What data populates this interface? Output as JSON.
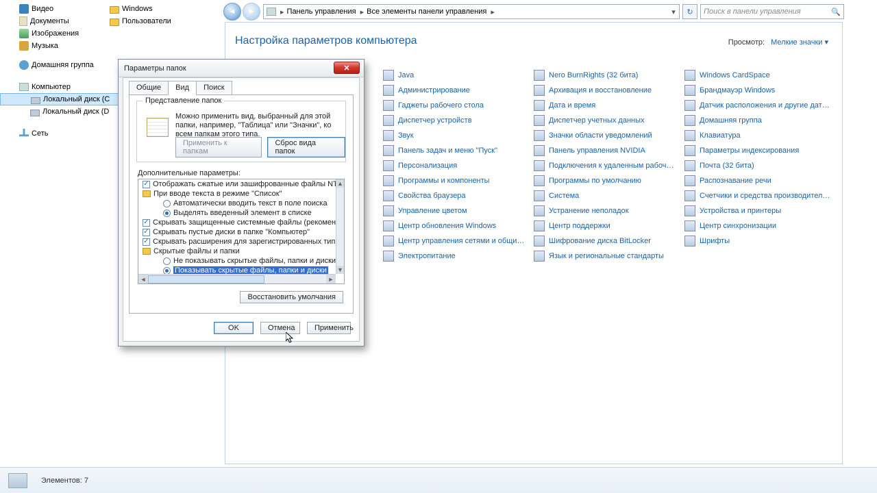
{
  "tree": {
    "video": "Видео",
    "documents": "Документы",
    "images": "Изображения",
    "music": "Музыка",
    "windows": "Windows",
    "users": "Пользователи",
    "homegroup": "Домашняя группа",
    "computer": "Компьютер",
    "localC": "Локальный диск (C",
    "localD": "Локальный диск (D",
    "network": "Сеть"
  },
  "address": {
    "seg1": "Панель управления",
    "seg2": "Все элементы панели управления",
    "search_placeholder": "Поиск в панели управления"
  },
  "heading": "Настройка параметров компьютера",
  "view": {
    "label": "Просмотр:",
    "value": "Мелкие значки"
  },
  "cp": {
    "col1": [
      "Java",
      "Администрирование",
      "Гаджеты рабочего стола",
      "Диспетчер устройств",
      "Звук",
      "Панель задач и меню \"Пуск\"",
      "Персонализация",
      "Программы и компоненты",
      "Свойства браузера",
      "Управление цветом",
      "Центр обновления Windows",
      "Центр управления сетями и общи…",
      "Электропитание"
    ],
    "col2": [
      "Nero BurnRights (32 бита)",
      "Архивация и восстановление",
      "Дата и время",
      "Диспетчер учетных данных",
      "Значки области уведомлений",
      "Панель управления NVIDIA",
      "Подключения к удаленным рабоч…",
      "Программы по умолчанию",
      "Система",
      "Устранение неполадок",
      "Центр поддержки",
      "Шифрование диска BitLocker",
      "Язык и региональные стандарты"
    ],
    "col3": [
      "Windows CardSpace",
      "Брандмауэр Windows",
      "Датчик расположения и другие дат…",
      "Домашняя группа",
      "Клавиатура",
      "Параметры индексирования",
      "Почта (32 бита)",
      "Распознавание речи",
      "Счетчики и средства производител…",
      "Устройства и принтеры",
      "Центр синхронизации",
      "Шрифты"
    ]
  },
  "status": {
    "text": "Элементов: 7"
  },
  "dialog": {
    "title": "Параметры папок",
    "tabs": {
      "general": "Общие",
      "view": "Вид",
      "search": "Поиск"
    },
    "group_title": "Представление папок",
    "group_text": "Можно применить вид, выбранный для этой папки, например, \"Таблица\" или \"Значки\", ко всем папкам этого типа.",
    "apply_folders": "Применить к папкам",
    "reset_folders": "Сброс вида папок",
    "advanced_label": "Дополнительные параметры:",
    "rows": {
      "r1": "Отображать сжатые или зашифрованные файлы NTI",
      "r2": "При вводе текста в режиме \"Список\"",
      "r3": "Автоматически вводить текст в поле поиска",
      "r4": "Выделять введенный элемент в списке",
      "r5": "Скрывать защищенные системные файлы (рекомен.",
      "r6": "Скрывать пустые диски в папке \"Компьютер\"",
      "r7": "Скрывать расширения для зарегистрированных тип",
      "r8": "Скрытые файлы и папки",
      "r9": "Не показывать скрытые файлы, папки и диски",
      "r10": "Показывать скрытые файлы, папки и диски"
    },
    "restore_defaults": "Восстановить умолчания",
    "ok": "OK",
    "cancel": "Отмена",
    "apply": "Применить"
  }
}
